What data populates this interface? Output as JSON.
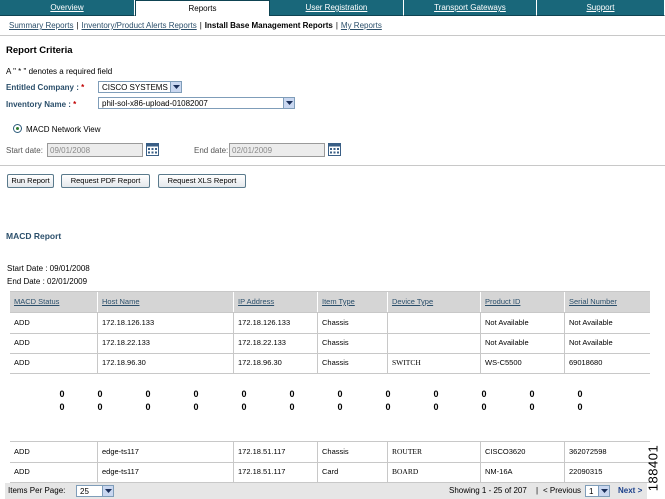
{
  "nav": {
    "tabs": [
      {
        "label": "Overview",
        "active": false
      },
      {
        "label": "Reports",
        "active": true
      },
      {
        "label": "User Registration",
        "active": false
      },
      {
        "label": "Transport Gateways",
        "active": false
      },
      {
        "label": "Support",
        "active": false
      }
    ]
  },
  "subnav": {
    "links": [
      "Summary Reports",
      "Inventory/Product Alerts Reports",
      "Install Base Management Reports",
      "My Reports"
    ],
    "separator": "|"
  },
  "criteria": {
    "title": "Report Criteria",
    "required_note": "A \" * \" denotes a required field",
    "company_label": "Entitled Company :",
    "company_value": "CISCO SYSTEMS",
    "inventory_label": "Inventory Name :",
    "inventory_value": "phil-sol-x86-upload-01082007",
    "asterisk": "*",
    "radio_label": "MACD Network View",
    "start_label": "Start date:",
    "start_value": "09/01/2008",
    "end_label": "End date:",
    "end_value": "02/01/2009"
  },
  "buttons": {
    "run": "Run Report",
    "pdf": "Request PDF Report",
    "xls": "Request XLS Report"
  },
  "report": {
    "title": "MACD Report",
    "start_line": "Start Date : 09/01/2008",
    "end_line": "End Date : 02/01/2009",
    "columns": [
      "MACD Status",
      "Host Name",
      "IP Address",
      "Item Type",
      "Device Type",
      "Product ID",
      "Serial Number"
    ],
    "rows_top": [
      [
        "ADD",
        "172.18.126.133",
        "172.18.126.133",
        "Chassis",
        "",
        "Not Available",
        "Not Available"
      ],
      [
        "ADD",
        "172.18.22.133",
        "172.18.22.133",
        "Chassis",
        "",
        "Not Available",
        "Not Available"
      ],
      [
        "ADD",
        "172.18.96.30",
        "172.18.96.30",
        "Chassis",
        "SWITCH",
        "WS-C5500",
        "69018680"
      ]
    ],
    "ellipsis_marks": [
      "0",
      "0"
    ],
    "rows_bottom": [
      [
        "ADD",
        "edge-ts117",
        "172.18.51.117",
        "Chassis",
        "ROUTER",
        "CISCO3620",
        "362072598"
      ],
      [
        "ADD",
        "edge-ts117",
        "172.18.51.117",
        "Card",
        "BOARD",
        "NM-16A",
        "22090315"
      ]
    ]
  },
  "footer": {
    "items_label": "Items Per Page:",
    "items_value": "25",
    "showing": "Showing 1 - 25 of 207",
    "sep": "|",
    "previous": "< Previous",
    "page_value": "1",
    "next": "Next >"
  },
  "figure_id": "188401"
}
